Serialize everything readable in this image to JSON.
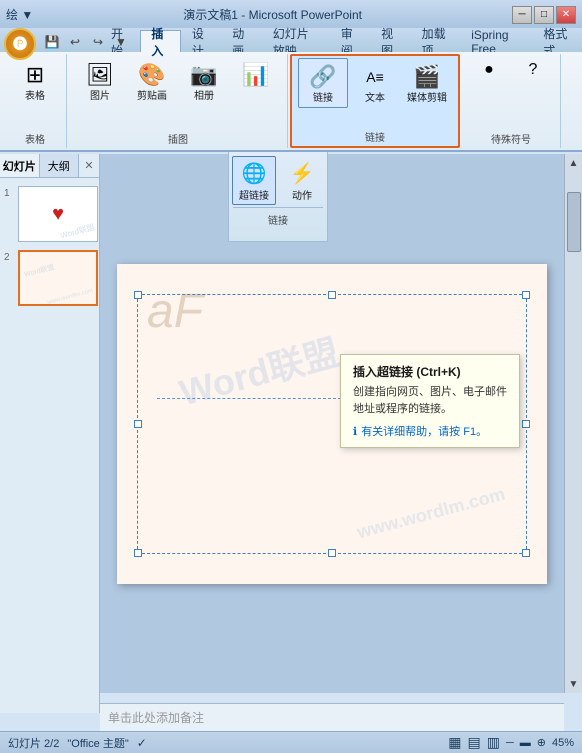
{
  "titlebar": {
    "title": "演示文稿1 - Microsoft PowerPoint",
    "min": "─",
    "max": "□",
    "close": "✕",
    "settings": "绘 ▼"
  },
  "quickaccess": {
    "save": "💾",
    "undo": "↩",
    "redo": "↪",
    "arrow": "▼"
  },
  "tabs": [
    "开始",
    "插入",
    "设计",
    "动画",
    "幻灯片放映",
    "审阅",
    "视图",
    "加载项",
    "iSpring Free",
    "格式式"
  ],
  "activeTab": "插入",
  "groups": {
    "table": {
      "label": "表格",
      "btn": "表格"
    },
    "images": {
      "label": "插图",
      "btns": [
        "图片",
        "剪贴画",
        "相册",
        "图表"
      ]
    },
    "links": {
      "label": "链接",
      "btns": [
        "超链接",
        "动作"
      ]
    },
    "text": {
      "label": "文本",
      "btn": "文本框"
    },
    "media": {
      "label": "媒体剪辑",
      "btn": "媒体剪辑"
    },
    "special": {
      "label": "待殊符号",
      "btns": [
        "●",
        "?"
      ]
    }
  },
  "ribbon2": {
    "hyperlink_label": "超链接",
    "action_label": "动作",
    "group_label": "链接"
  },
  "tooltip": {
    "title": "插入超链接 (Ctrl+K)",
    "body": "创建指向网页、图片、电子邮件地址或程序的链接。",
    "link": "有关详细帮助，请按 F1。"
  },
  "slides": [
    {
      "num": "1",
      "has_heart": true
    },
    {
      "num": "2",
      "has_heart": false,
      "active": true
    }
  ],
  "panel_tabs": [
    "幻灯片",
    "大纲"
  ],
  "notes_placeholder": "单击此处添加备注",
  "statusbar": {
    "slide_info": "幻灯片 2/2",
    "theme": "\"Office 主题\"",
    "zoom": "45%",
    "icons": [
      "▦",
      "▤",
      "▥",
      "🔍",
      "─",
      "⊕"
    ]
  },
  "watermarks": [
    "Word联盟",
    "Word联盟",
    "www.wordlm.com"
  ],
  "canvas_text": "aF"
}
